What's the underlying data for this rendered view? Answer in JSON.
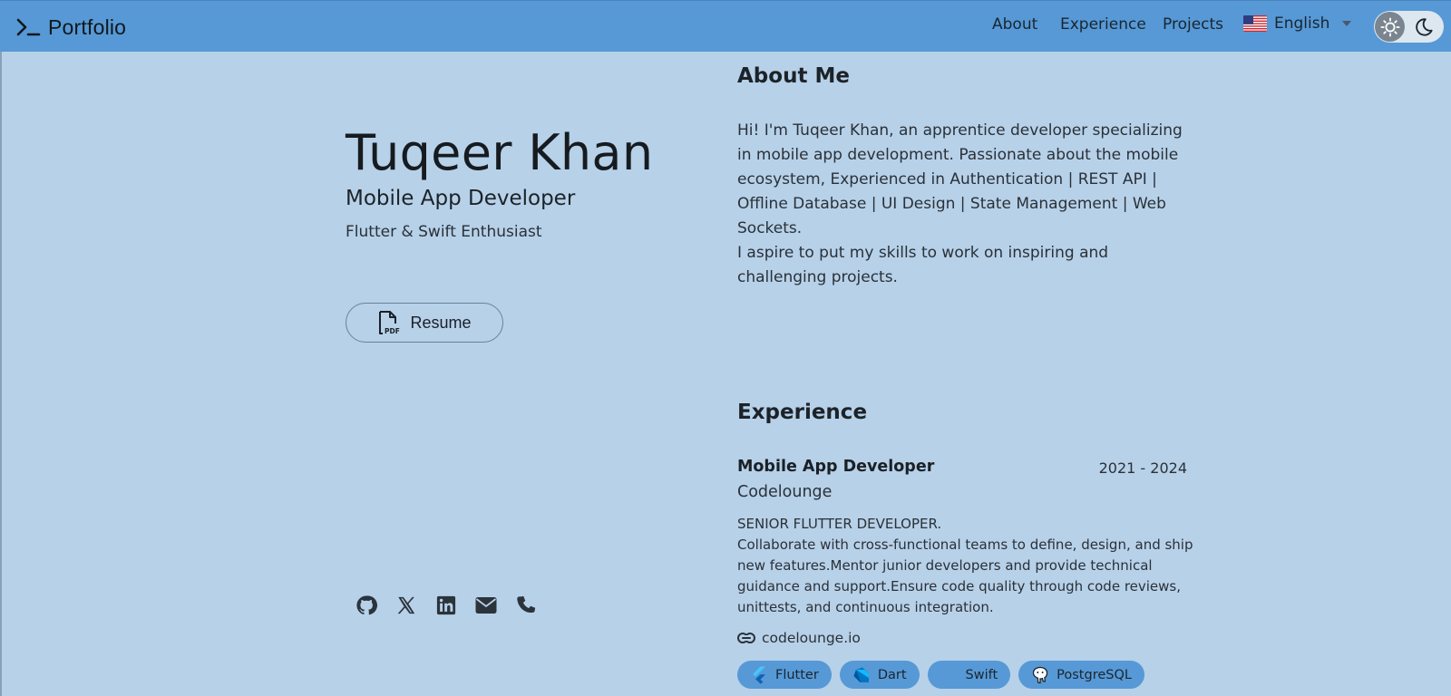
{
  "navbar": {
    "brand": "Portfolio",
    "links": [
      "About",
      "Experience",
      "Projects"
    ],
    "language": "English",
    "language_icon": "us-flag-icon",
    "theme_icons": [
      "sun-icon",
      "moon-icon"
    ],
    "background": "#5699d6"
  },
  "hero": {
    "name": "Tuqeer Khan",
    "role": "Mobile App Developer",
    "tagline": "Flutter & Swift Enthusiast",
    "resume_label": "Resume",
    "resume_icon": "pdf-file-icon",
    "socials": [
      "github-icon",
      "x-icon",
      "linkedin-icon",
      "email-icon",
      "phone-icon"
    ]
  },
  "about": {
    "heading": "About Me",
    "lines": [
      "Hi! I'm Tuqeer Khan, an apprentice developer specializing",
      "in mobile app development. Passionate about the mobile",
      "ecosystem, Experienced in Authentication | REST API |",
      "Offline Database | UI Design | State Management | Web",
      "Sockets.",
      "I aspire to put my skills to work on inspiring and",
      "challenging projects."
    ]
  },
  "experience": {
    "heading": "Experience",
    "job": {
      "title": "Mobile App Developer",
      "dates": "2021 - 2024",
      "company": "Codelounge",
      "description_lines": [
        "SENIOR FLUTTER DEVELOPER.",
        "Collaborate with cross-functional teams to define, design, and ship",
        "new features.Mentor junior developers and provide technical",
        "guidance and support.Ensure code quality through code reviews,",
        "unittests, and continuous integration."
      ],
      "link": "codelounge.io",
      "chips": [
        {
          "label": "Flutter",
          "icon": "flutter-icon"
        },
        {
          "label": "Dart",
          "icon": "dart-icon"
        },
        {
          "label": "Swift",
          "icon": "swift-icon"
        },
        {
          "label": "PostgreSQL",
          "icon": "postgresql-icon"
        }
      ]
    }
  },
  "colors": {
    "page_background": "#b7d1e9",
    "accent": "#5699d6"
  }
}
